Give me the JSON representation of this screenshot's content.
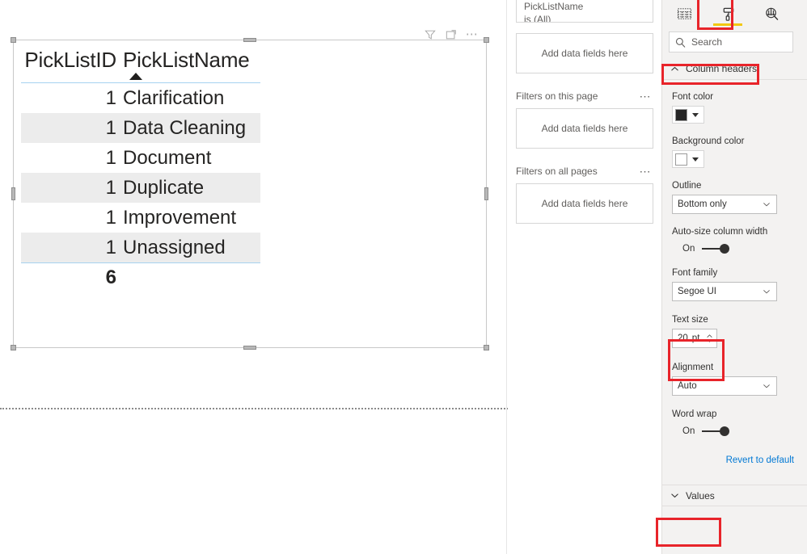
{
  "visual_header": {
    "filter_icon": "filter-icon",
    "focus_icon": "focus-mode-icon",
    "more_icon": "more-options-ellipsis"
  },
  "table_visual": {
    "columns": [
      "PickListID",
      "PickListName"
    ],
    "sort": {
      "column": "PickListName",
      "direction": "ascending",
      "indicator": "sort-ascending-arrow"
    },
    "rows": [
      {
        "id": "1",
        "name": "Clarification"
      },
      {
        "id": "1",
        "name": "Data Cleaning"
      },
      {
        "id": "1",
        "name": "Document"
      },
      {
        "id": "1",
        "name": "Duplicate"
      },
      {
        "id": "1",
        "name": "Improvement"
      },
      {
        "id": "1",
        "name": "Unassigned"
      }
    ],
    "total": "6",
    "header_rule_color": "#a6d2f0",
    "alt_row_color": "#ececec"
  },
  "filters_pane": {
    "applied_filter": {
      "field": "PickListName",
      "condition": "is (All)"
    },
    "visual_dropzone": "Add data fields here",
    "sections": [
      {
        "label": "Filters on this page",
        "dropzone": "Add data fields here",
        "menu": "⋯"
      },
      {
        "label": "Filters on all pages",
        "dropzone": "Add data fields here",
        "menu": "⋯"
      }
    ]
  },
  "format_pane": {
    "tabs": [
      {
        "name": "fields-tab",
        "icon": "table-fields-icon",
        "selected": false
      },
      {
        "name": "format-tab",
        "icon": "paint-roller-icon",
        "selected": true
      },
      {
        "name": "analytics-tab",
        "icon": "analytics-magnifier-icon",
        "selected": false
      }
    ],
    "accent_color": "#f2c811",
    "search": {
      "placeholder": "Search",
      "icon": "search-icon"
    },
    "column_headers": {
      "title": "Column headers",
      "expanded": true,
      "chevron": "chevron-up-icon",
      "properties": {
        "font_color": {
          "label": "Font color",
          "value": "#262626"
        },
        "background_color": {
          "label": "Background color",
          "value": "#ffffff"
        },
        "outline": {
          "label": "Outline",
          "value": "Bottom only"
        },
        "auto_size_column_width": {
          "label": "Auto-size column width",
          "value": "On"
        },
        "font_family": {
          "label": "Font family",
          "value": "Segoe UI"
        },
        "text_size": {
          "label": "Text size",
          "value": "20",
          "unit": "pt"
        },
        "alignment": {
          "label": "Alignment",
          "value": "Auto"
        },
        "word_wrap": {
          "label": "Word wrap",
          "value": "On"
        }
      },
      "revert_link": "Revert to default"
    },
    "values_section": {
      "title": "Values",
      "expanded": false,
      "chevron": "chevron-down-icon"
    }
  },
  "annotations": {
    "color": "#e8242a",
    "highlighted": [
      "format-tab",
      "Column headers",
      "Text size",
      "Values"
    ]
  }
}
